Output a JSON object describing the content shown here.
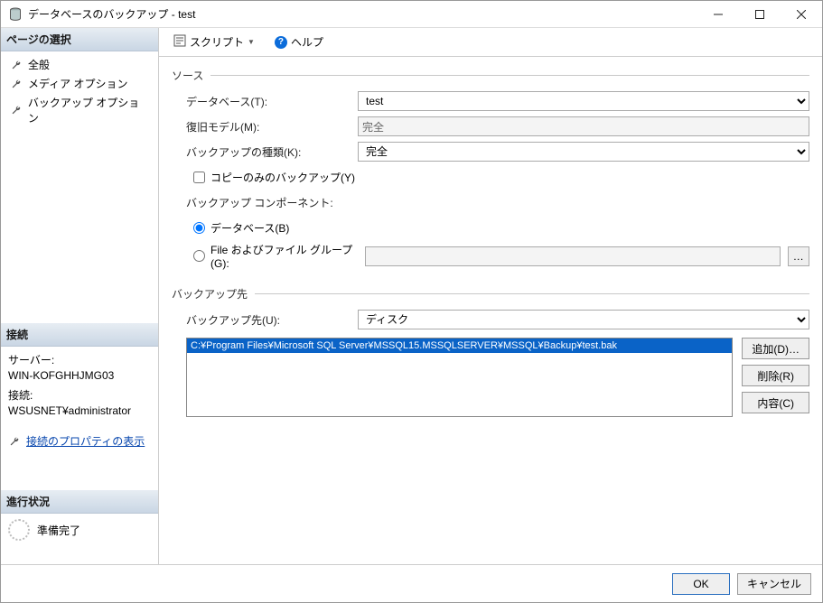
{
  "window": {
    "title": "データベースのバックアップ - test"
  },
  "sidebar": {
    "pages_header": "ページの選択",
    "items": [
      {
        "label": "全般"
      },
      {
        "label": "メディア オプション"
      },
      {
        "label": "バックアップ オプション"
      }
    ],
    "connection_header": "接続",
    "server_label": "サーバー:",
    "server_value": "WIN-KOFGHHJMG03",
    "conn_label": "接続:",
    "conn_value": "WSUSNET¥administrator",
    "conn_props_link": "接続のプロパティの表示",
    "progress_header": "進行状況",
    "progress_text": "準備完了"
  },
  "toolbar": {
    "script": "スクリプト",
    "help": "ヘルプ"
  },
  "source": {
    "legend": "ソース",
    "database_label": "データベース(T):",
    "database_value": "test",
    "recovery_label": "復旧モデル(M):",
    "recovery_value": "完全",
    "backup_type_label": "バックアップの種類(K):",
    "backup_type_value": "完全",
    "copy_only_label": "コピーのみのバックアップ(Y)",
    "component_label": "バックアップ コンポーネント:",
    "comp_db": "データベース(B)",
    "comp_files": "File およびファイル グループ(G):"
  },
  "dest": {
    "legend": "バックアップ先",
    "backup_to_label": "バックアップ先(U):",
    "backup_to_value": "ディスク",
    "path": "C:¥Program Files¥Microsoft SQL Server¥MSSQL15.MSSQLSERVER¥MSSQL¥Backup¥test.bak",
    "add": "追加(D)…",
    "remove": "削除(R)",
    "contents": "内容(C)"
  },
  "footer": {
    "ok": "OK",
    "cancel": "キャンセル"
  }
}
